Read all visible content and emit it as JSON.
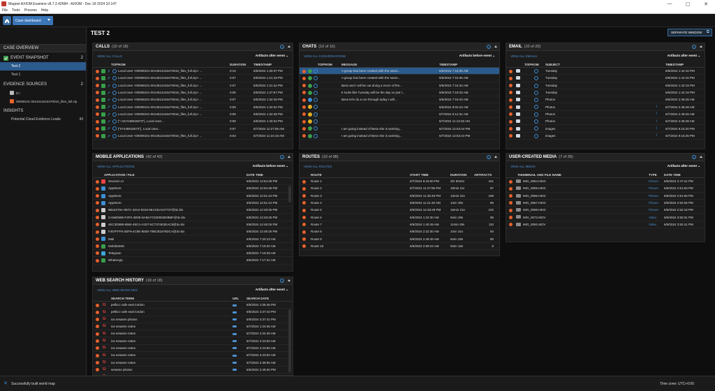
{
  "window": {
    "title": "Magnet AXIOM Examine v8.7.2.42684 - AXIOM - Dec 18 2024 10:14?",
    "min": "—",
    "max": "▢",
    "close": "✕"
  },
  "menu": [
    "File",
    "Tools",
    "Process",
    "Help"
  ],
  "toolbar": {
    "dashboard": "Case dashboard"
  },
  "case_title": "TEST 2",
  "separate_window": "SEPARATE WINDOW",
  "sidebar": {
    "overview": "CASE OVERVIEW",
    "snapshot": {
      "label": "EVENT SNAPSHOT",
      "count": "2",
      "items": [
        "Test 2",
        "Test 1"
      ]
    },
    "evidence": {
      "label": "EVIDENCE SOURCES",
      "count": "2",
      "items": [
        "D:\\",
        "00008101-0014513416470016_files_full.zip"
      ]
    },
    "insights": {
      "label": "INSIGHTS",
      "items": [
        {
          "label": "Potential Cloud Evidence Leads",
          "count": "43"
        }
      ]
    }
  },
  "common": {
    "artifacts_after": "Artifacts after event",
    "artifacts_before": "Artifacts before event"
  },
  "calls": {
    "title": "CALLS",
    "count": "(10 of 18)",
    "view_all": "VIEW ALL CALLS",
    "cols": [
      "TO/FROM",
      "DURATION",
      "TIMESTAMP"
    ],
    "rows": [
      [
        "Local User <00008101-0014513416470016_files_full.zip> ...",
        "0:13",
        "6/6/2024 1:30:37 PM"
      ],
      [
        "Local User <00008101-0014513416470016_files_full.zip> ...",
        "0:07",
        "6/6/2024 1:21:19 PM"
      ],
      [
        "Local User <00008101-0014513416470016_files_full.zip> ...",
        "0:07",
        "6/6/2024 1:31:42 PM"
      ],
      [
        "Local User <00008101-0014513416470016_files_full.zip> ...",
        "0:05",
        "6/6/2024 1:37:57 PM"
      ],
      [
        "Local User <00008101-0014513416470016_files_full.zip> ...",
        "0:07",
        "6/6/2024 1:32:18 PM"
      ],
      [
        "Local User <00008101-0014513416470016_files_full.zip> ...",
        "0:09",
        "6/6/2024 1:33:32 PM"
      ],
      [
        "Local User <00008101-0014513416470016_files_full.zip> ...",
        "0:09",
        "6/6/2024 1:32:48 PM"
      ],
      [
        "[\"+447448815073\"], Local User...",
        "0:09",
        "6/6/2024 1:40:34 PM"
      ],
      [
        "[\"07448815073\"], Local User...",
        "0:07",
        "6/7/2024 11:27:59 AM"
      ],
      [
        "Local User <00008101-0014513416470016_files_full.zip> ...",
        "0:03",
        "6/7/2024 11:24:16 AM"
      ]
    ]
  },
  "chats": {
    "title": "CHATS",
    "count": "(10 of 16)",
    "view_all": "VIEW ALL CONVERSATIONS",
    "cols": [
      "TO/FROM",
      "MESSAGE",
      "TIMESTAMP"
    ],
    "rows": [
      [
        "",
        "A group has been created with the name...",
        "6/6/2024 7:15:35 AM"
      ],
      [
        "",
        "A group has been created with the name...",
        "6/6/2024 7:15:35 AM"
      ],
      [
        "",
        "Bess and I will be out doing a recce of the...",
        "6/6/2024 7:16:34 AM"
      ],
      [
        "",
        "It looks like Tuesday will be the day so just l...",
        "6/6/2024 7:19:33 AM"
      ],
      [
        "",
        "Bess let's do a run through today I will...",
        "6/6/2024 7:19:43 AM"
      ],
      [
        "",
        "",
        "6/6/2024 8:02:22 AM"
      ],
      [
        "",
        "",
        "6/7/2024 5:12:31 AM"
      ],
      [
        "",
        "",
        "6/7/2024 11:13:33 AM"
      ],
      [
        "",
        "I am going instead of Bess she is working...",
        "6/7/2024 12:53:44 PM"
      ],
      [
        "",
        "I am going instead of Bess she is working...",
        "6/7/2024 12:53:44 PM"
      ]
    ]
  },
  "email": {
    "title": "EMAIL",
    "count": "(10 of 20)",
    "view_all": "VIEW ALL EMAILS",
    "cols": [
      "TO/FROM",
      "SUBJECT",
      "TIMESTAMP"
    ],
    "rows": [
      [
        "Tuesday",
        "6/6/2024 1:42:16 PM"
      ],
      [
        "Tuesday",
        "6/6/2024 1:42:16 PM"
      ],
      [
        "Tuesday",
        "6/6/2024 1:42:19 PM"
      ],
      [
        "Tuesday",
        "6/6/2024 1:42:19 PM"
      ],
      [
        "Photos",
        "6/6/2024 2:48:49 AM"
      ],
      [
        "Photos",
        "6/7/2024 2:48:49 AM"
      ],
      [
        "Photos",
        "6/7/2024 2:48:49 AM"
      ],
      [
        "Photos",
        "6/7/2024 2:48:49 AM"
      ],
      [
        "images",
        "6/7/2024 9:15:20 PM"
      ],
      [
        "images",
        "6/7/2024 9:15:26 PM"
      ]
    ]
  },
  "mobile": {
    "title": "MOBILE APPLICATIONS",
    "count": "(42 of 42)",
    "view_all": "VIEW ALL APPLICATIONS",
    "cols": [
      "APPLICATION / FILE",
      "DATE TIME"
    ],
    "rows": [
      [
        "Sexnarn.cz",
        "6/6/2024 12:54:28 PM"
      ],
      [
        "AppStore",
        "6/6/2024 12:54:28 PM"
      ],
      [
        "AppStore",
        "6/6/2024 12:51:24 PM"
      ],
      [
        "AppStore",
        "6/6/2024 12:51:24 PM"
      ],
      [
        "8B16278A-097C-43A2-9318-5EACEA247737@3x.ktx",
        "6/6/2024 12:49:25 PM"
      ],
      [
        "CA56D596-F4F0-4D0E-8A56-FCDD052E8B6F@3x.ktx",
        "6/6/2024 12:49:25 PM"
      ],
      [
        "4EC3D898-6584-45C4-A1D7-5C7374E3EAC8@3x.ktx",
        "6/6/2024 12:49:25 PM"
      ],
      [
        "F457FFF8-2DF9-4C9E-8828-70BCB1676DCA@3x.ktx",
        "6/6/2024 12:49:25 PM"
      ],
      [
        "Mail",
        "6/6/2024 7:20:13 AM"
      ],
      [
        "MobileSMS",
        "6/6/2024 7:19:20 AM"
      ],
      [
        "Telegram",
        "6/6/2024 7:19:29 AM"
      ],
      [
        "WhatsApp",
        "6/6/2024 7:17:41 AM"
      ]
    ]
  },
  "routes": {
    "title": "ROUTES",
    "count": "(10 of 98)",
    "view_all": "VIEW ALL ROUTES",
    "cols": [
      "ROUTE",
      "START TIME",
      "DURATION",
      "ARTIFACTS"
    ],
    "rows": [
      [
        "Route 1",
        "6/7/2024 8:43:50 PM",
        "2hr 50min",
        "441"
      ],
      [
        "Route 2",
        "6/7/2024 11:27:06 PM",
        "18min 11s",
        "97"
      ],
      [
        "Route 3",
        "6/6/2024 11:48:49 PM",
        "13min 31s",
        "198"
      ],
      [
        "Route 4",
        "6/6/2024 11:21:46 AM",
        "1min 35s",
        "86"
      ],
      [
        "Route 5",
        "6/6/2024 12:48:49 PM",
        "15min 21s",
        "102"
      ],
      [
        "Route 6",
        "6/6/2024 1:22:30 AM",
        "6min 28s",
        "95"
      ],
      [
        "Route 7",
        "6/6/2024 1:40:49 AM",
        "11min 29s",
        "110"
      ],
      [
        "Route 8",
        "6/6/2024 2:22:30 AM",
        "1min 31s",
        "93"
      ],
      [
        "Route 9",
        "6/6/2024 2:48:49 AM",
        "6min 28s",
        "90"
      ],
      [
        "Route 10",
        "6/6/2024 2:59:24 AM",
        "0min 16s",
        "8"
      ]
    ]
  },
  "media": {
    "title": "USER-CREATED MEDIA",
    "count": "(7 of 35)",
    "view_all": "VIEW ALL MEDIA",
    "cols": [
      "THUMBNAIL AND FILE NAME",
      "TYPE",
      "DATE TIME"
    ],
    "rows": [
      [
        "IMG_0064.HEIC",
        "Picture",
        "6/6/2024 2:47:41 PM"
      ],
      [
        "IMG_0065.HEIC",
        "Picture",
        "6/6/2024 2:51:53 PM"
      ],
      [
        "IMG_0066.HEIC",
        "Picture",
        "6/6/2024 2:51:56 PM"
      ],
      [
        "IMG_0067.HEIC",
        "Picture",
        "6/6/2024 2:52:06 PM"
      ],
      [
        "IMG_0068.HEIC",
        "Picture",
        "6/6/2024 2:52:15 PM"
      ],
      [
        "IMG_0072.MOV",
        "Video",
        "6/6/2024 3:50:31 PM"
      ],
      [
        "IMG_0091.MOV",
        "Video",
        "6/6/2024 3:52:41 PM"
      ]
    ]
  },
  "websearch": {
    "title": "WEB SEARCH HISTORY",
    "count": "(18 of 18)",
    "view_all": "VIEW ALL WEB SEARCHES",
    "cols": [
      "SEARCH TERM",
      "URL",
      "SEARCH DATE"
    ],
    "rows": [
      [
        "pellicci cafe east london",
        "6/6/2024 1:06:46 PM"
      ],
      [
        "pellicci cafe east london",
        "6/6/2024 3:37:43 PM"
      ],
      [
        "ios sesame photos",
        "6/6/2024 3:37:41 PM"
      ],
      [
        "ios sesame notes",
        "6/7/2024 1:23:45 AM"
      ],
      [
        "ios sesame notes",
        "6/7/2024 2:22:45 AM"
      ],
      [
        "ios sesame notes",
        "6/7/2024 2:23:50 AM"
      ],
      [
        "ios sesame notes",
        "6/7/2024 2:23:56 AM"
      ],
      [
        "ios sesame notes",
        "6/7/2024 2:23:52 AM"
      ],
      [
        "ios sesame notes",
        "6/7/2024 2:39:56 AM"
      ],
      [
        "sesame photos",
        "6/6/2024 2:49:26 PM"
      ],
      [
        "sesame photos",
        "6/7/2024 2:48:20 AM"
      ]
    ]
  },
  "status": {
    "message": "Successfully built world map",
    "timezone": "Time zone:  UTC+0:00"
  },
  "colors": {
    "accent": "#3b76b8",
    "dot": "#e8612c",
    "link": "#4f8fd0"
  }
}
